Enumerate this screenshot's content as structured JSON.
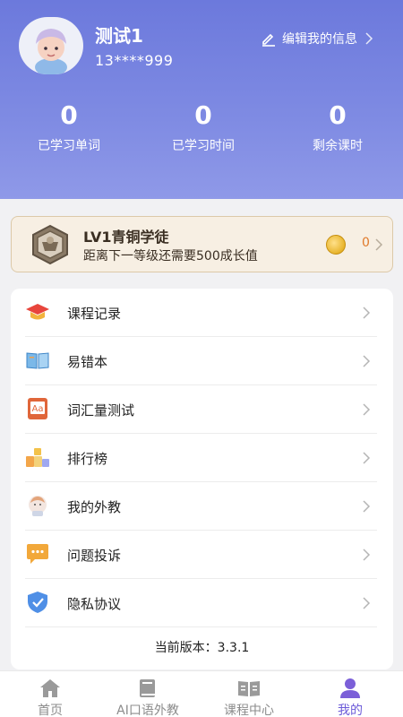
{
  "profile": {
    "username": "测试1",
    "phone": "13****999",
    "edit_label": "编辑我的信息"
  },
  "stats": [
    {
      "value": "0",
      "label": "已学习单词"
    },
    {
      "value": "0",
      "label": "已学习时间"
    },
    {
      "value": "0",
      "label": "剩余课时"
    }
  ],
  "level": {
    "title": "LV1青铜学徒",
    "subtitle": "距离下一等级还需要500成长值",
    "coins": "0"
  },
  "menu": {
    "items": [
      {
        "label": "课程记录",
        "icon": "graduation-cap-icon"
      },
      {
        "label": "易错本",
        "icon": "open-book-icon"
      },
      {
        "label": "词汇量测试",
        "icon": "vocab-test-icon"
      },
      {
        "label": "排行榜",
        "icon": "ranking-blocks-icon"
      },
      {
        "label": "我的外教",
        "icon": "teacher-avatar-icon"
      },
      {
        "label": "问题投诉",
        "icon": "chat-bubble-icon"
      },
      {
        "label": "隐私协议",
        "icon": "shield-check-icon"
      }
    ],
    "version_label": "当前版本：3.3.1"
  },
  "tabs": [
    {
      "label": "首页",
      "icon": "home-icon"
    },
    {
      "label": "AI口语外教",
      "icon": "book-icon"
    },
    {
      "label": "课程中心",
      "icon": "course-book-icon"
    },
    {
      "label": "我的",
      "icon": "person-icon",
      "active": true
    }
  ],
  "colors": {
    "header_gradient_top": "#6c79dc",
    "header_gradient_bottom": "#8f99e8",
    "accent_active_tab": "#6c5bd9",
    "coin_text": "#e07a2b"
  }
}
